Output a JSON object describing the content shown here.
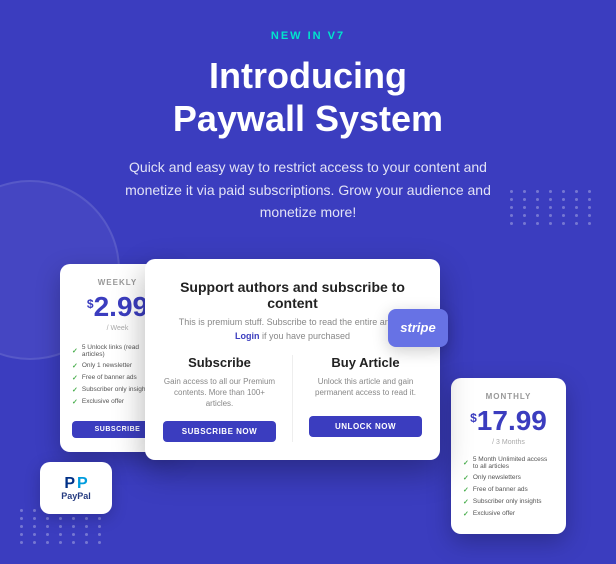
{
  "page": {
    "background_color": "#3b3dbf"
  },
  "badge": {
    "text": "NEW IN V7"
  },
  "hero": {
    "title": "Introducing\nPaywall System",
    "subtitle": "Quick and easy way to restrict access to your content and monetize it via paid subscriptions. Grow your audience and monetize more!"
  },
  "weekly_card": {
    "label": "WEEKLY",
    "currency": "$",
    "price": "2.99",
    "period": "/ Week",
    "features": [
      "5 Unlock links (read articles)",
      "Only 1 newsletter",
      "Free of banner ads",
      "Subscriber only insights",
      "Exclusive offer"
    ],
    "button_label": "SUBSCRIBE"
  },
  "monthly_card": {
    "label": "MONTHLY",
    "currency": "$",
    "price": "17.99",
    "period": "/ 3 Months",
    "features": [
      "5 Month Unlimited access to all articles",
      "Only newsletters",
      "Free of banner ads",
      "Subscriber only insights",
      "Exclusive offer"
    ]
  },
  "paywall_modal": {
    "title": "Support authors and subscribe to content",
    "subtitle": "This is premium stuff. Subscribe to read the entire article.",
    "login_text": "Login",
    "login_suffix": " if you have purchased",
    "subscribe_option": {
      "title": "Subscribe",
      "description": "Gain access to all our Premium contents. More than 100+ articles.",
      "button_label": "SUBSCRIBE NOW"
    },
    "buy_option": {
      "title": "Buy Article",
      "description": "Unlock this article and gain permanent access to read it.",
      "button_label": "UNLOCK NOW"
    }
  },
  "paypal": {
    "text": "PayPal"
  },
  "stripe": {
    "text": "stripe"
  },
  "dots": {
    "count": 35
  }
}
